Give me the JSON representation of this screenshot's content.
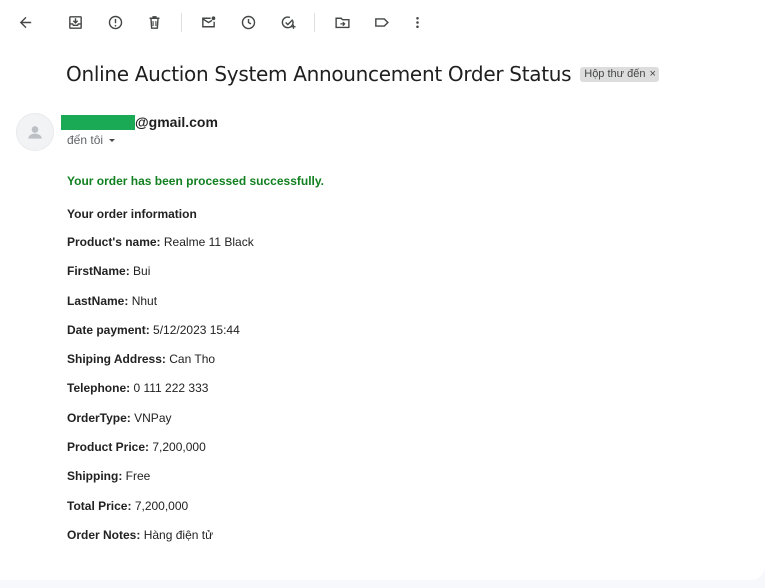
{
  "email": {
    "subject": "Online Auction System Announcement Order Status",
    "label": "Hộp thư đến",
    "label_close": "×",
    "sender_domain": "@gmail.com",
    "recipient": "đến tôi",
    "success_message": "Your order has been processed successfully.",
    "info_title": "Your order information",
    "fields": [
      {
        "label": "Product's name:",
        "value": "Realme 11 Black"
      },
      {
        "label": "FirstName:",
        "value": "Bui"
      },
      {
        "label": "LastName:",
        "value": "Nhut"
      },
      {
        "label": "Date payment:",
        "value": "5/12/2023 15:44"
      },
      {
        "label": "Shiping Address:",
        "value": "Can Tho"
      },
      {
        "label": "Telephone:",
        "value": "0 111 222 333"
      },
      {
        "label": "OrderType:",
        "value": "VNPay"
      },
      {
        "label": "Product Price:",
        "value": "7,200,000"
      },
      {
        "label": "Shipping:",
        "value": "Free"
      },
      {
        "label": "Total Price:",
        "value": "7,200,000"
      },
      {
        "label": "Order Notes:",
        "value": "Hàng điện tử"
      }
    ]
  },
  "toolbar": {
    "icons": [
      "back-arrow-icon",
      "archive-icon",
      "report-spam-icon",
      "delete-icon",
      "mark-unread-icon",
      "snooze-icon",
      "add-task-icon",
      "move-to-icon",
      "label-icon",
      "more-icon"
    ]
  },
  "colors": {
    "success_green": "#118020",
    "redaction_green": "#1aaa55"
  }
}
